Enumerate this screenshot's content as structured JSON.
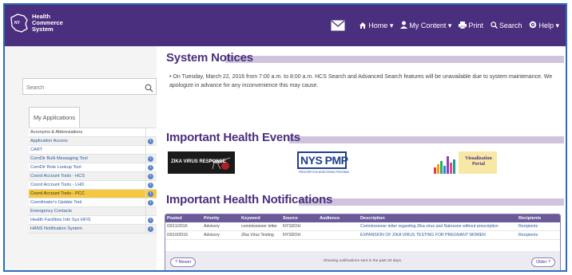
{
  "header": {
    "logo_text": [
      "Health",
      "Commerce",
      "System"
    ],
    "nav": [
      {
        "label": "Home",
        "icon": "home-icon",
        "caret": true
      },
      {
        "label": "My Content",
        "icon": "user-icon",
        "caret": true
      },
      {
        "label": "Print",
        "icon": "printer-icon",
        "caret": false
      },
      {
        "label": "Search",
        "icon": "search-icon",
        "caret": false
      },
      {
        "label": "Help",
        "icon": "gear-icon",
        "caret": true
      }
    ],
    "bg_color": "#4b2f7f"
  },
  "sidebar": {
    "search_placeholder": "Search",
    "tab_label": "My Applications",
    "apps": [
      {
        "label": "Acronyms & Abbreviations",
        "info": false,
        "style": "plain-link"
      },
      {
        "label": "Application Access",
        "info": true,
        "style": "link"
      },
      {
        "label": "CART",
        "info": false,
        "style": "link"
      },
      {
        "label": "ComDir Bulk Messaging Tool",
        "info": true,
        "style": "link"
      },
      {
        "label": "ComDir Role Lookup Tool",
        "info": true,
        "style": "link"
      },
      {
        "label": "Coord Account Tools - HCS",
        "info": true,
        "style": "link"
      },
      {
        "label": "Coord Account Tools - LHD",
        "info": true,
        "style": "link"
      },
      {
        "label": "Coord Account Tools - PCC",
        "info": true,
        "style": "highlight"
      },
      {
        "label": "Coordinator's Update Tool",
        "info": true,
        "style": "link"
      },
      {
        "label": "Emergency Contacts",
        "info": false,
        "style": "link"
      },
      {
        "label": "Health Facilities Info Sys HFIS",
        "info": true,
        "style": "link"
      },
      {
        "label": "HANS Notification System",
        "info": true,
        "style": "link"
      }
    ]
  },
  "main": {
    "system_notices_title": "System Notices",
    "notice_text": "On Tuesday, March 22, 2016 from 7:00 a.m. to 8:00 a.m. HCS Search and Advanced Search features will be unavailable due to system maintenance. We apologize in advance for any inconvenience this may cause.",
    "events_title": "Important Health Events",
    "events": [
      {
        "label": "ZIKA VIRUS RESPONSE"
      },
      {
        "label": "NYS PMP",
        "sub": "PRESCRIPTION MONITORING PROGRAM"
      },
      {
        "label": "Visualization Portal"
      }
    ],
    "notifications_title": "Important Health Notifications",
    "table": {
      "columns": [
        "Posted",
        "Priority",
        "Keyword",
        "Source",
        "Audience",
        "Description",
        "Recipients"
      ],
      "rows": [
        [
          "03/11/2016",
          "Advisory",
          "commissioner letter",
          "NYSDOH",
          "",
          "Commissioner letter regarding Zika virus and Naloxone without prescription",
          "Recipients"
        ],
        [
          "03/10/2016",
          "Advisory",
          "Zika Virus Testing",
          "NYSDOH",
          "",
          "EXPANSION OF ZIKA VIRUS TESTING FOR PREGNANT WOMEN",
          "Recipients"
        ]
      ],
      "newer_label": "? Newer",
      "older_label": "Older ?",
      "footer_note": "Showing notifications sent in the past 30 days."
    }
  }
}
